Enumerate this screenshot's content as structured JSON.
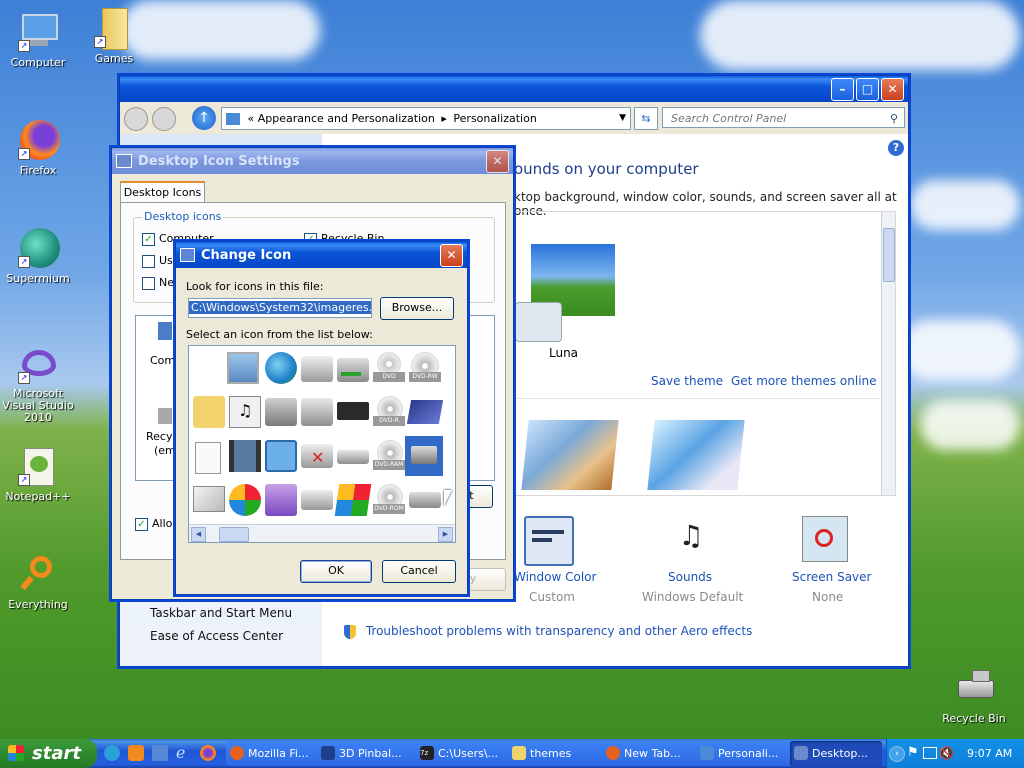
{
  "desktop": {
    "icons": [
      {
        "label": "Computer"
      },
      {
        "label": "Games"
      },
      {
        "label": "Firefox"
      },
      {
        "label": "Supermium"
      },
      {
        "label": "Microsoft Visual Studio 2010"
      },
      {
        "label": "Notepad++"
      },
      {
        "label": "Everything"
      },
      {
        "label": "Recycle Bin"
      }
    ]
  },
  "control_panel": {
    "breadcrumb_prefix": "«",
    "breadcrumb_1": "Appearance and Personalization",
    "breadcrumb_sep": "▸",
    "breadcrumb_2": "Personalization",
    "search_placeholder": "Search Control Panel",
    "heading": "ounds on your computer",
    "subheading": "ktop background, window color, sounds, and screen saver all at once.",
    "theme_name": "Luna",
    "save_theme": "Save theme",
    "get_more_themes": "Get more themes online",
    "bottom_items": [
      {
        "title": "Window Color",
        "value": "Custom"
      },
      {
        "title": "Sounds",
        "value": "Windows Default"
      },
      {
        "title": "Screen Saver",
        "value": "None"
      }
    ],
    "sidebar_links": [
      "Taskbar and Start Menu",
      "Ease of Access Center"
    ],
    "troubleshoot": "Troubleshoot problems with transparency and other Aero effects"
  },
  "desktop_icon_settings": {
    "title": "Desktop Icon Settings",
    "tab": "Desktop Icons",
    "group": "Desktop icons",
    "checks": [
      {
        "label": "Computer",
        "checked": true
      },
      {
        "label": "Recycle Bin",
        "checked": true
      },
      {
        "label": "Us",
        "checked": false
      },
      {
        "label": "Ne",
        "checked": false
      }
    ],
    "preview_labels": [
      "Comp",
      "Recyc",
      "(em"
    ],
    "allow_label": "Allow",
    "default_btn": "ault",
    "apply_btn": "ply"
  },
  "change_icon": {
    "title": "Change Icon",
    "look_label": "Look for icons in this file:",
    "file_path": "C:\\Windows\\System32\\imageres.dll",
    "browse": "Browse...",
    "select_label": "Select an icon from the list below:",
    "ok": "OK",
    "cancel": "Cancel",
    "icon_labels": [
      "DVD",
      "DVD-RW",
      "DVD-R",
      "DVD-RAM",
      "DVD-ROM"
    ]
  },
  "taskbar": {
    "start": "start",
    "tasks": [
      "Mozilla Fi...",
      "3D Pinbal...",
      "C:\\Users\\...",
      "themes",
      "New Tab...",
      "Personali...",
      "Desktop..."
    ],
    "clock": "9:07 AM"
  },
  "colors": {
    "accent": "#0a47d4",
    "link": "#1f52b8",
    "start_green": "#2f8a2f"
  }
}
